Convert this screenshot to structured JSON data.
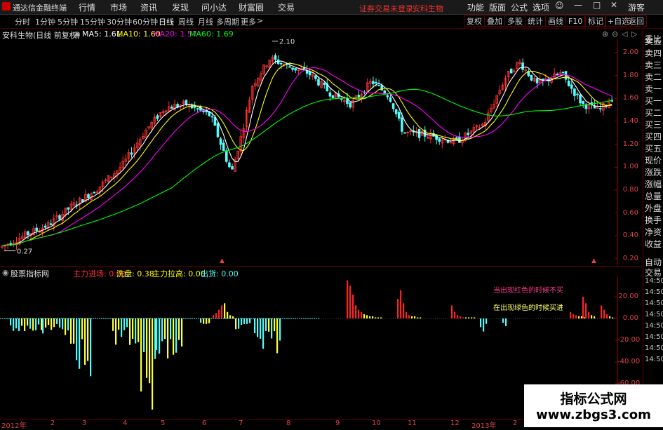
{
  "titlebar": {
    "app_name": "通达信金融终端",
    "menus": [
      "行情",
      "市场",
      "资讯",
      "发现",
      "问小达",
      "财富圈",
      "交易"
    ],
    "warning": "证券交易未登录",
    "stock": "安科生物",
    "right_menus": [
      "功能",
      "版面",
      "公式",
      "选项"
    ],
    "guest": "游客"
  },
  "toolbar": {
    "periods": [
      "分时",
      "1分钟",
      "5分钟",
      "15分钟",
      "30分钟",
      "60分钟",
      "日线",
      "周线",
      "月线",
      "多周期",
      "更多"
    ],
    "active_period": "日线",
    "right_buttons": [
      "复权",
      "叠加",
      "多股",
      "统计",
      "画线",
      "F10",
      "标记",
      "+自选",
      "返回"
    ]
  },
  "infoline": {
    "title": "安科生物(日线 前复权)",
    "ma5": "MA5: 1.61",
    "ma10": "MA10: 1.60",
    "ma20": "MA20: 1.57",
    "ma60": "MA60: 1.69"
  },
  "main_chart": {
    "y_labels": [
      "2.00",
      "1.80",
      "1.60",
      "1.40",
      "1.20",
      "1.00",
      "0.80",
      "0.60",
      "0.40",
      "0.20"
    ],
    "high_label": "2.10",
    "low_label": "0.27"
  },
  "indicator": {
    "name": "股票指标网",
    "v1": "主力进场: 0.00",
    "v2": "洗盘: 0.38",
    "v3": "主力拉高: 0.00",
    "v4": "出货: 0.00",
    "note_red": "当出现红色的时候不买",
    "note_yellow": "在出现绿色的时候买进",
    "y_labels": [
      "20.00",
      "0.00",
      "-20.00",
      "-40.00",
      "-60.00"
    ]
  },
  "xaxis": [
    "2012年",
    "2",
    "3",
    "4",
    "5",
    "6",
    "7",
    "8",
    "9",
    "10",
    "11",
    "12",
    "2013年",
    "2"
  ],
  "right_column": [
    "委比",
    "卖五",
    "卖四",
    "卖三",
    "卖二",
    "卖一",
    "买一",
    "买二",
    "买三",
    "买四",
    "买五",
    "现价",
    "涨跌",
    "涨幅",
    "总量",
    "外盘",
    "换手",
    "净资",
    "收益",
    "自动",
    "交易",
    "14:50",
    "14:50",
    "14:50",
    "14:50",
    "14:50",
    "14:50",
    "14:50",
    "14:50"
  ],
  "watermark": {
    "line1": "指标公式网",
    "line2": "www.zbgs3.com"
  },
  "colors": {
    "up": "#ff3232",
    "down": "#54fcfc",
    "ma5": "#ffffff",
    "ma10": "#ffff00",
    "ma20": "#ff00ff",
    "ma60": "#00ff00",
    "axis": "#a00000"
  }
}
